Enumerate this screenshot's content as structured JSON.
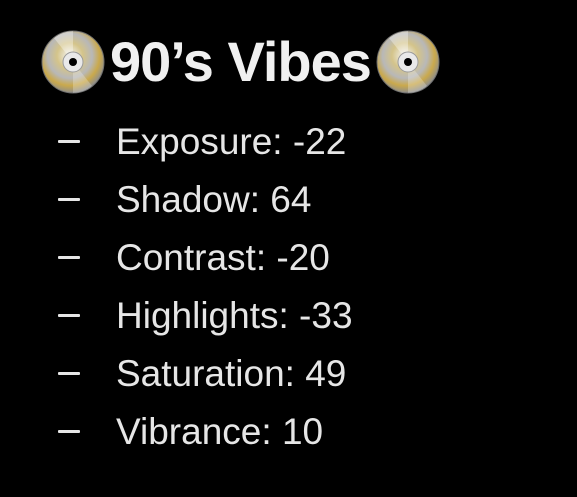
{
  "header": {
    "title": "90’s Vibes",
    "left_icon": "optical-disc-icon",
    "right_icon": "optical-disc-icon"
  },
  "settings": [
    {
      "label": "Exposure:",
      "value": "-22"
    },
    {
      "label": "Shadow:",
      "value": "64"
    },
    {
      "label": "Contrast:",
      "value": "-20"
    },
    {
      "label": "Highlights:",
      "value": "-33"
    },
    {
      "label": "Saturation:",
      "value": "49"
    },
    {
      "label": "Vibrance:",
      "value": "10"
    }
  ],
  "colors": {
    "background": "#000000",
    "text": "#e6e6e6",
    "disc_gold": "#c9a94a",
    "disc_silver": "#d8d8d8"
  }
}
